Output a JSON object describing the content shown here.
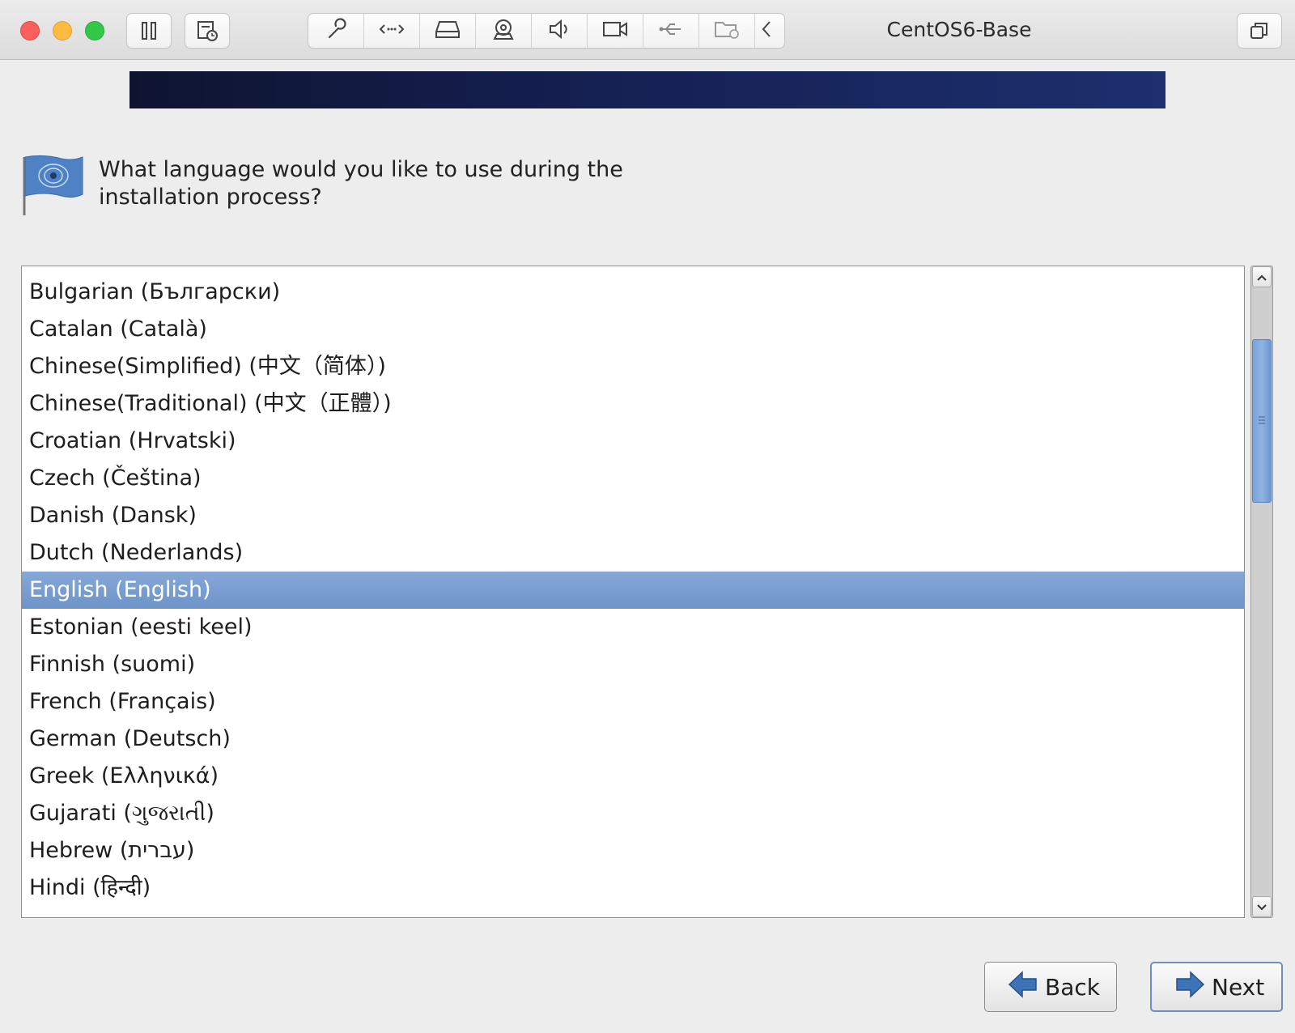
{
  "window": {
    "title": "CentOS6-Base",
    "toolbar_icons": [
      "pause-icon",
      "snapshot-icon",
      "settings-icon",
      "network-icon",
      "hard-disk-icon",
      "camera-icon",
      "sound-icon",
      "video-icon",
      "usb-icon",
      "shared-folder-icon",
      "chevron-left-icon",
      "fullscreen-icon"
    ]
  },
  "installer": {
    "question": "What language would you like to use during the installation process?",
    "languages": [
      "Bulgarian (Български)",
      "Catalan (Català)",
      "Chinese(Simplified) (中文（简体）)",
      "Chinese(Traditional) (中文（正體）)",
      "Croatian (Hrvatski)",
      "Czech (Čeština)",
      "Danish (Dansk)",
      "Dutch (Nederlands)",
      "English (English)",
      "Estonian (eesti keel)",
      "Finnish (suomi)",
      "French (Français)",
      "German (Deutsch)",
      "Greek (Ελληνικά)",
      "Gujarati (ગુજરાતી)",
      "Hebrew (עברית)",
      "Hindi (हिन्दी)"
    ],
    "selected_language": "English (English)",
    "back_label": "Back",
    "next_label": "Next"
  },
  "colors": {
    "selection": "#7399cc",
    "banner": "#152052"
  }
}
